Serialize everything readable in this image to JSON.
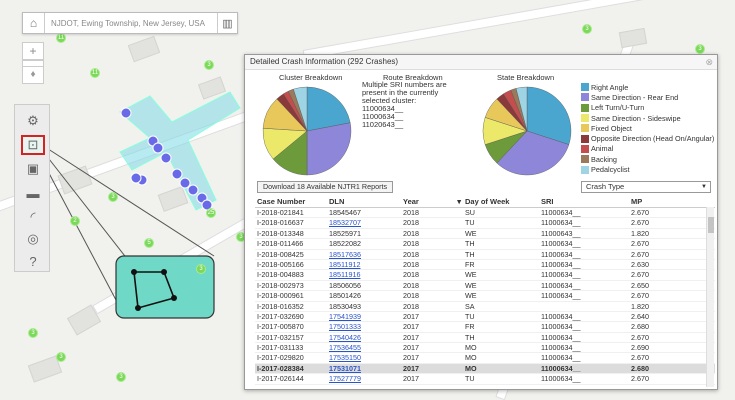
{
  "search": {
    "placeholder": "NJDOT, Ewing Township, New Jersey, USA"
  },
  "zoom": {
    "in": "+",
    "out": "−"
  },
  "clusters": [
    "11",
    "11",
    "3",
    "5",
    "3",
    "2",
    "3",
    "3",
    "3",
    "25",
    "3",
    "3",
    "3",
    "3"
  ],
  "panel": {
    "title": "Detailed Crash Information (292 Crashes)",
    "close": "⊗",
    "cluster_breakdown": "Cluster Breakdown",
    "route_breakdown": "Route Breakdown",
    "route_note": "Multiple SRI numbers are present in the currently selected cluster:",
    "route_sris": [
      "11000634__",
      "11000634__",
      "11020643__"
    ],
    "state_breakdown": "State Breakdown",
    "download_label": "Download 18 Available NJTR1 Reports",
    "select_value": "Crash Type"
  },
  "legend": [
    {
      "label": "Right Angle",
      "color": "#4aa6cf"
    },
    {
      "label": "Same Direction - Rear End",
      "color": "#8e86d8"
    },
    {
      "label": "Left Turn/U-Turn",
      "color": "#6d9a3a"
    },
    {
      "label": "Same Direction - Sideswipe",
      "color": "#ece86a"
    },
    {
      "label": "Fixed Object",
      "color": "#e8c85a"
    },
    {
      "label": "Opposite Direction (Head On/Angular)",
      "color": "#8a3a3a"
    },
    {
      "label": "Animal",
      "color": "#c44e4e"
    },
    {
      "label": "Backing",
      "color": "#9a7a5a"
    },
    {
      "label": "Pedalcyclist",
      "color": "#9ed4e4"
    }
  ],
  "table": {
    "headers": [
      "Case Number",
      "DLN",
      "Year",
      "Day of Week",
      "SRI",
      "MP"
    ],
    "sort_icon": "▾",
    "rows": [
      [
        "I-2018-021841",
        "18545467",
        "2018",
        "SU",
        "11000634__",
        "2.670",
        false
      ],
      [
        "I-2018-016637",
        "18532707",
        "2018",
        "TU",
        "11000634__",
        "2.670",
        true
      ],
      [
        "I-2018-013348",
        "18525971",
        "2018",
        "WE",
        "11000643__",
        "1.820",
        false
      ],
      [
        "I-2018-011466",
        "18522082",
        "2018",
        "TH",
        "11000634__",
        "2.670",
        false
      ],
      [
        "I-2018-008425",
        "18517636",
        "2018",
        "TH",
        "11000634__",
        "2.670",
        true
      ],
      [
        "I-2018-005166",
        "18511912",
        "2018",
        "FR",
        "11000634__",
        "2.630",
        true
      ],
      [
        "I-2018-004883",
        "18511916",
        "2018",
        "WE",
        "11000634__",
        "2.670",
        true
      ],
      [
        "I-2018-002973",
        "18506056",
        "2018",
        "WE",
        "11000634__",
        "2.650",
        false
      ],
      [
        "I-2018-000961",
        "18501426",
        "2018",
        "WE",
        "11000634__",
        "2.670",
        false
      ],
      [
        "I-2018-016352",
        "18530493",
        "2018",
        "SA",
        "",
        "1.820",
        false
      ],
      [
        "I-2017-032690",
        "17541939",
        "2017",
        "TU",
        "11000634__",
        "2.640",
        true
      ],
      [
        "I-2017-005870",
        "17501333",
        "2017",
        "FR",
        "11000634__",
        "2.680",
        true
      ],
      [
        "I-2017-032157",
        "17540426",
        "2017",
        "TH",
        "11000634__",
        "2.670",
        true
      ],
      [
        "I-2017-031133",
        "17536455",
        "2017",
        "MO",
        "11000634__",
        "2.690",
        true
      ],
      [
        "I-2017-029820",
        "17535150",
        "2017",
        "MO",
        "11000634__",
        "2.670",
        true
      ],
      [
        "I-2017-028384",
        "17531071",
        "2017",
        "MO",
        "11000634__",
        "2.680",
        true
      ],
      [
        "I-2017-026144",
        "17527779",
        "2017",
        "TU",
        "11000634__",
        "2.670",
        true
      ]
    ],
    "selected_index": 15
  },
  "chart_data": [
    {
      "type": "pie",
      "title": "Cluster Breakdown",
      "categories": [
        "Right Angle",
        "Same Direction - Rear End",
        "Left Turn/U-Turn",
        "Same Direction - Sideswipe",
        "Fixed Object",
        "Opposite Direction (Head On/Angular)",
        "Animal",
        "Backing",
        "Pedalcyclist"
      ],
      "values": [
        22,
        28,
        14,
        12,
        12,
        3,
        2,
        2,
        5
      ]
    },
    {
      "type": "pie",
      "title": "State Breakdown",
      "categories": [
        "Right Angle",
        "Same Direction - Rear End",
        "Left Turn/U-Turn",
        "Same Direction - Sideswipe",
        "Fixed Object",
        "Opposite Direction (Head On/Angular)",
        "Animal",
        "Backing",
        "Pedalcyclist"
      ],
      "values": [
        30,
        32,
        8,
        10,
        8,
        3,
        3,
        2,
        4
      ]
    }
  ]
}
